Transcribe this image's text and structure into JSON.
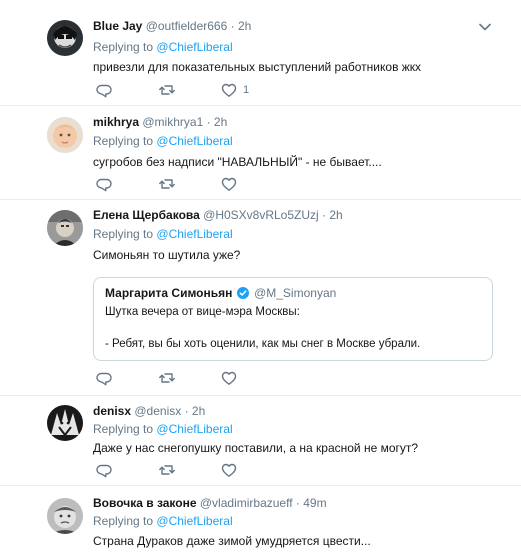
{
  "tweets": [
    {
      "name": "Blue Jay",
      "handle": "@outfielder666",
      "time": "· 2h",
      "replying_prefix": "Replying to",
      "replying_to": "@ChiefLiberal",
      "text": "привезли для показательных выступлений работников жкх",
      "like_count": "1"
    },
    {
      "name": "mikhrya",
      "handle": "@mikhrya1",
      "time": "· 2h",
      "replying_prefix": "Replying to",
      "replying_to": "@ChiefLiberal",
      "text": "сугробов без надписи \"НАВАЛЬНЫЙ\" - не бывает...."
    },
    {
      "name": "Елена Щербакова",
      "handle": "@H0SXv8vRLo5ZUzj",
      "time": "· 2h",
      "replying_prefix": "Replying to",
      "replying_to": "@ChiefLiberal",
      "text": "Симоньян то шутила уже?",
      "quote": {
        "name": "Маргарита Симоньян",
        "handle": "@M_Simonyan",
        "line1": "Шутка вечера от вице-мэра Москвы:",
        "line2": "- Ребят, вы бы хоть оценили, как мы снег в Москве убрали."
      }
    },
    {
      "name": "denisx",
      "handle": "@denisx",
      "time": "· 2h",
      "replying_prefix": "Replying to",
      "replying_to": "@ChiefLiberal",
      "text": "Даже у нас снегопушку поставили, а на красной не могут?"
    },
    {
      "name": "Вовочка в законе",
      "handle": "@vladimirbazueff",
      "time": "· 49m",
      "replying_prefix": "Replying to",
      "replying_to": "@ChiefLiberal",
      "text": "Страна Дураков даже зимой умудряется цвести..."
    }
  ],
  "icons": {
    "reply": "reply-icon",
    "retweet": "retweet-icon",
    "like": "heart-icon",
    "more": "chevron-down-icon",
    "verified": "verified-badge-icon"
  },
  "colors": {
    "link": "#1da1f2",
    "muted": "#657786",
    "text": "#14171a",
    "border": "#e6ecf0"
  }
}
